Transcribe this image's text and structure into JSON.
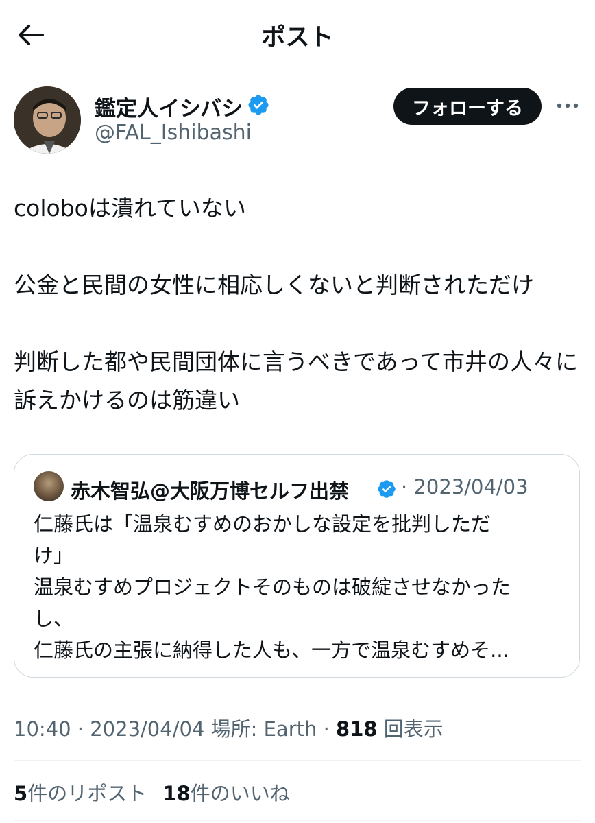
{
  "header": {
    "title": "ポスト",
    "back_icon": "arrow-left-icon"
  },
  "author": {
    "name": "鑑定人イシバシ",
    "handle": "@FAL_Ishibashi",
    "verified": true,
    "follow_label": "フォローする"
  },
  "post": {
    "paragraphs": [
      "coloboは潰れていない",
      "公金と民間の女性に相応しくないと判断されただけ",
      "判断した都や民間団体に言うべきであって市井の人々に訴えかけるのは筋違い"
    ]
  },
  "quote": {
    "name": "赤木智弘@大阪万博セルフ出禁",
    "date": "· 2023/04/03",
    "lines": [
      "仁藤氏は「温泉むすめのおかしな設定を批判しただ",
      "け」",
      "温泉むすめプロジェクトそのものは破綻させなかった",
      "し、",
      "仁藤氏の主張に納得した人も、一方で温泉むすめそ..."
    ]
  },
  "meta": {
    "time": "10:40",
    "date": "2023/04/04",
    "location": "場所: Earth",
    "views": "818",
    "views_label": "回表示"
  },
  "stats": {
    "reposts": "5",
    "reposts_label": "件のリポスト",
    "likes": "18",
    "likes_label": "件のいいね"
  },
  "colors": {
    "text": "#0f1419",
    "secondary": "#536471",
    "verified": "#1d9bf0",
    "border": "#cfd9de"
  }
}
